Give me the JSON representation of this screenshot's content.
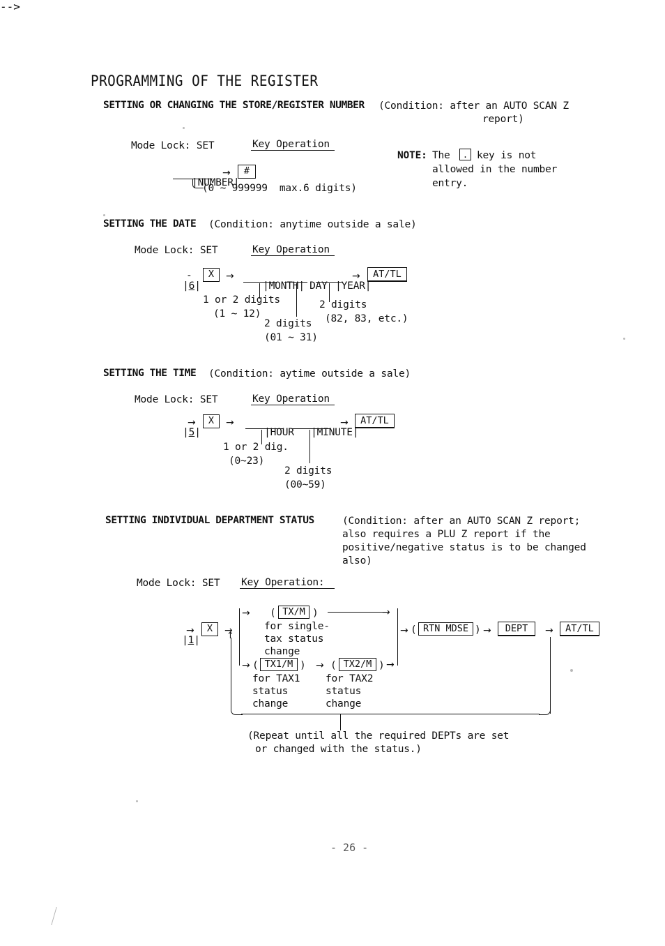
{
  "document": {
    "title": "PROGRAMMING OF THE REGISTER",
    "page_number": "- 26 -"
  },
  "sections": [
    {
      "id": "store-register-number",
      "heading": "SETTING OR CHANGING THE STORE/REGISTER NUMBER",
      "condition_line1": "(Condition: after an AUTO SCAN Z",
      "condition_line2": "report)",
      "mode_lock": "Mode Lock: SET",
      "key_operation_label": "Key Operation",
      "flow": {
        "field": "NUMBER",
        "arrow": "→",
        "key": "#",
        "range_note": "(0 ~ 999999  max.6 digits)"
      },
      "note": {
        "label": "NOTE:",
        "line1_before": "The",
        "key": ".",
        "line1_after": "key is not",
        "line2": "allowed in the number",
        "line3": "entry."
      }
    },
    {
      "id": "setting-the-date",
      "heading": "SETTING THE DATE",
      "condition_line1": "(Condition: anytime outside a sale)",
      "mode_lock": "Mode Lock: SET",
      "key_operation_label": "Key Operation",
      "flow": {
        "digit": "6",
        "dash": "-",
        "x_key": "X",
        "arrow": "→",
        "fields": [
          "MONTH",
          "DAY",
          "YEAR"
        ],
        "total_key": "AT/TL"
      },
      "annotations": [
        {
          "line1": "1 or 2 digits",
          "line2": "(1 ~ 12)"
        },
        {
          "line1": "2 digits",
          "line2": "(01 ~ 31)"
        },
        {
          "line1": "2 digits",
          "line2": "(82, 83, etc.)"
        }
      ]
    },
    {
      "id": "setting-the-time",
      "heading": "SETTING THE TIME",
      "condition_line1": "(Condition: aytime outside a sale)",
      "mode_lock": "Mode Lock: SET",
      "key_operation_label": "Key Operation",
      "flow": {
        "digit": "5",
        "arrow": "→",
        "x_key": "X",
        "fields": [
          "HOUR",
          "MINUTE"
        ],
        "total_key": "AT/TL"
      },
      "annotations": [
        {
          "line1": "1 or 2 dig.",
          "line2": "(0~23)"
        },
        {
          "line1": "2 digits",
          "line2": "(00~59)"
        }
      ]
    },
    {
      "id": "department-status",
      "heading": "SETTING INDIVIDUAL DEPARTMENT STATUS",
      "condition_line1": "(Condition: after an AUTO SCAN Z report;",
      "condition_line2": "also requires a PLU Z report if the",
      "condition_line3": "positive/negative status is to be changed",
      "condition_line4": "also)",
      "mode_lock": "Mode Lock: SET",
      "key_operation_label": "Key Operation:",
      "flow": {
        "digit": "1",
        "x_key": "X",
        "arrow": "→",
        "branch_top": {
          "open_paren": "(",
          "key": "TX/M",
          "close_paren": ")",
          "caption_line1": "for single-",
          "caption_line2": "tax status",
          "caption_line3": "change"
        },
        "branch_bottom_first": {
          "open_paren": "(",
          "key": "TX1/M",
          "close_paren": ")",
          "caption_line1": "for TAX1",
          "caption_line2": "status",
          "caption_line3": "change"
        },
        "branch_bottom_second": {
          "open_paren": "(",
          "key": "TX2/M",
          "close_paren": ")",
          "caption_line1": "for TAX2",
          "caption_line2": "status",
          "caption_line3": "change"
        },
        "rtn_mdse": {
          "open_paren": "(",
          "key": "RTN MDSE",
          "close_paren": ")"
        },
        "dept_key": "DEPT",
        "total_key": "AT/TL"
      },
      "repeat_note_line1": "(Repeat until all the required DEPTs are set",
      "repeat_note_line2": "or changed with the status.)"
    }
  ]
}
